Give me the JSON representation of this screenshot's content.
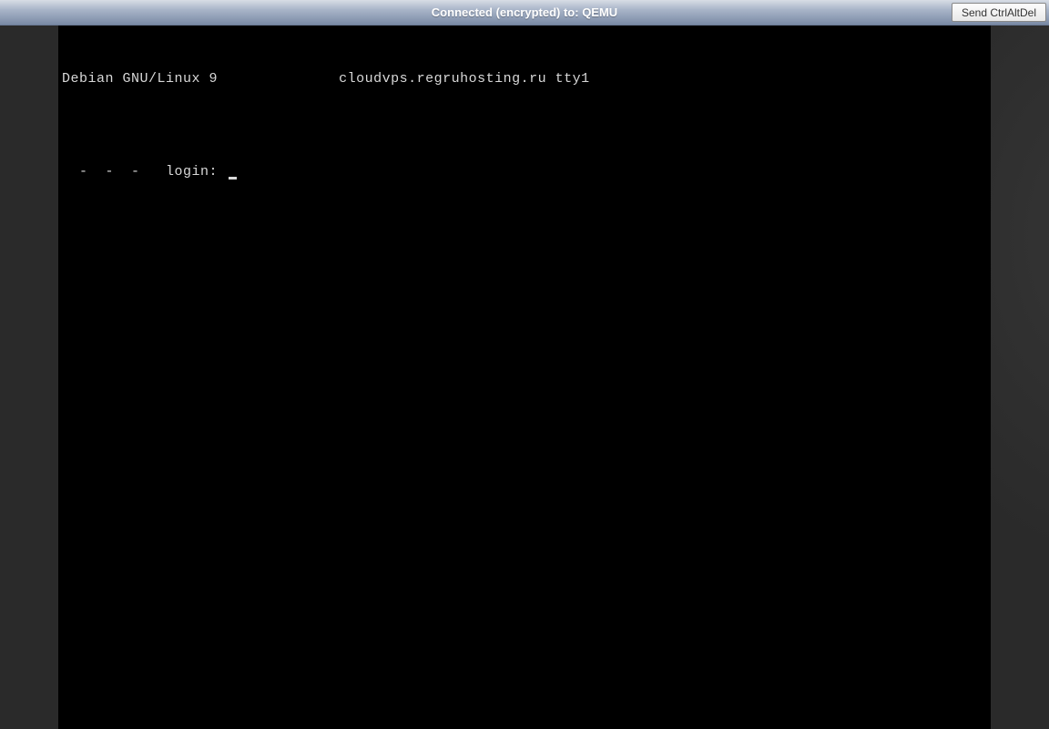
{
  "header": {
    "connection_status": "Connected (encrypted) to: QEMU",
    "ctrlaltdel_label": "Send CtrlAltDel"
  },
  "terminal": {
    "banner_os": "Debian GNU/Linux 9",
    "banner_host": "cloudvps.regruhosting.ru tty1",
    "login_prefix": "  -  -  -   login: "
  }
}
